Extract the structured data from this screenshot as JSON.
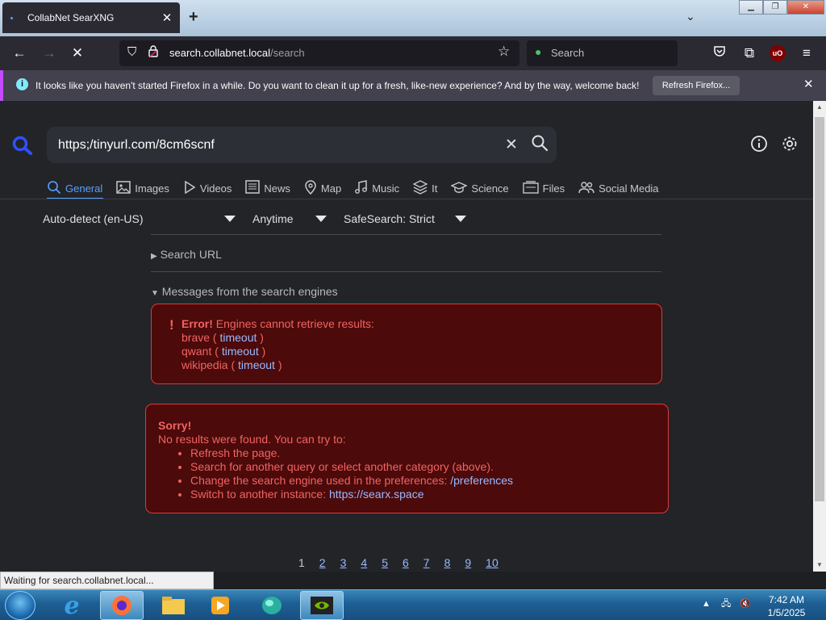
{
  "browser": {
    "tab_title": "CollabNet SearXNG",
    "url_host": "search.collabnet.local",
    "url_path": "/search",
    "search_placeholder": "Search",
    "ubo_badge": "uO"
  },
  "notification": {
    "message": "It looks like you haven't started Firefox in a while. Do you want to clean it up for a fresh, like-new experience? And by the way, welcome back!",
    "button": "Refresh Firefox..."
  },
  "search": {
    "query": "https;/tinyurl.com/8cm6scnf"
  },
  "categories": [
    {
      "label": "General",
      "icon": "search-icon"
    },
    {
      "label": "Images",
      "icon": "image-icon"
    },
    {
      "label": "Videos",
      "icon": "play-icon"
    },
    {
      "label": "News",
      "icon": "newspaper-icon"
    },
    {
      "label": "Map",
      "icon": "map-pin-icon"
    },
    {
      "label": "Music",
      "icon": "music-note-icon"
    },
    {
      "label": "It",
      "icon": "layers-icon"
    },
    {
      "label": "Science",
      "icon": "graduation-cap-icon"
    },
    {
      "label": "Files",
      "icon": "files-icon"
    },
    {
      "label": "Social Media",
      "icon": "people-icon"
    }
  ],
  "filters": {
    "language": "Auto-detect (en-US)",
    "time": "Anytime",
    "safesearch": "SafeSearch: Strict"
  },
  "sections": {
    "search_url": "Search URL",
    "messages": "Messages from the search engines"
  },
  "engine_error": {
    "title": "Error!",
    "text": "Engines cannot retrieve results:",
    "engines": [
      {
        "name": "brave",
        "reason": "timeout"
      },
      {
        "name": "qwant",
        "reason": "timeout"
      },
      {
        "name": "wikipedia",
        "reason": "timeout"
      }
    ]
  },
  "no_results": {
    "title": "Sorry!",
    "text": "No results were found. You can try to:",
    "items": [
      "Refresh the page.",
      "Search for another query or select another category (above).",
      "Change the search engine used in the preferences:"
    ],
    "preferences_link": "/preferences",
    "instance_text": "Switch to another instance:",
    "instance_link": "https://searx.space"
  },
  "pagination": [
    "1",
    "2",
    "3",
    "4",
    "5",
    "6",
    "7",
    "8",
    "9",
    "10"
  ],
  "status_text": "Waiting for search.collabnet.local...",
  "clock": {
    "time": "7:42 AM",
    "date": "1/5/2025"
  },
  "colors": {
    "accent": "#5aa0ff",
    "error": "#f26363",
    "error_bg": "#4c0a0a"
  }
}
